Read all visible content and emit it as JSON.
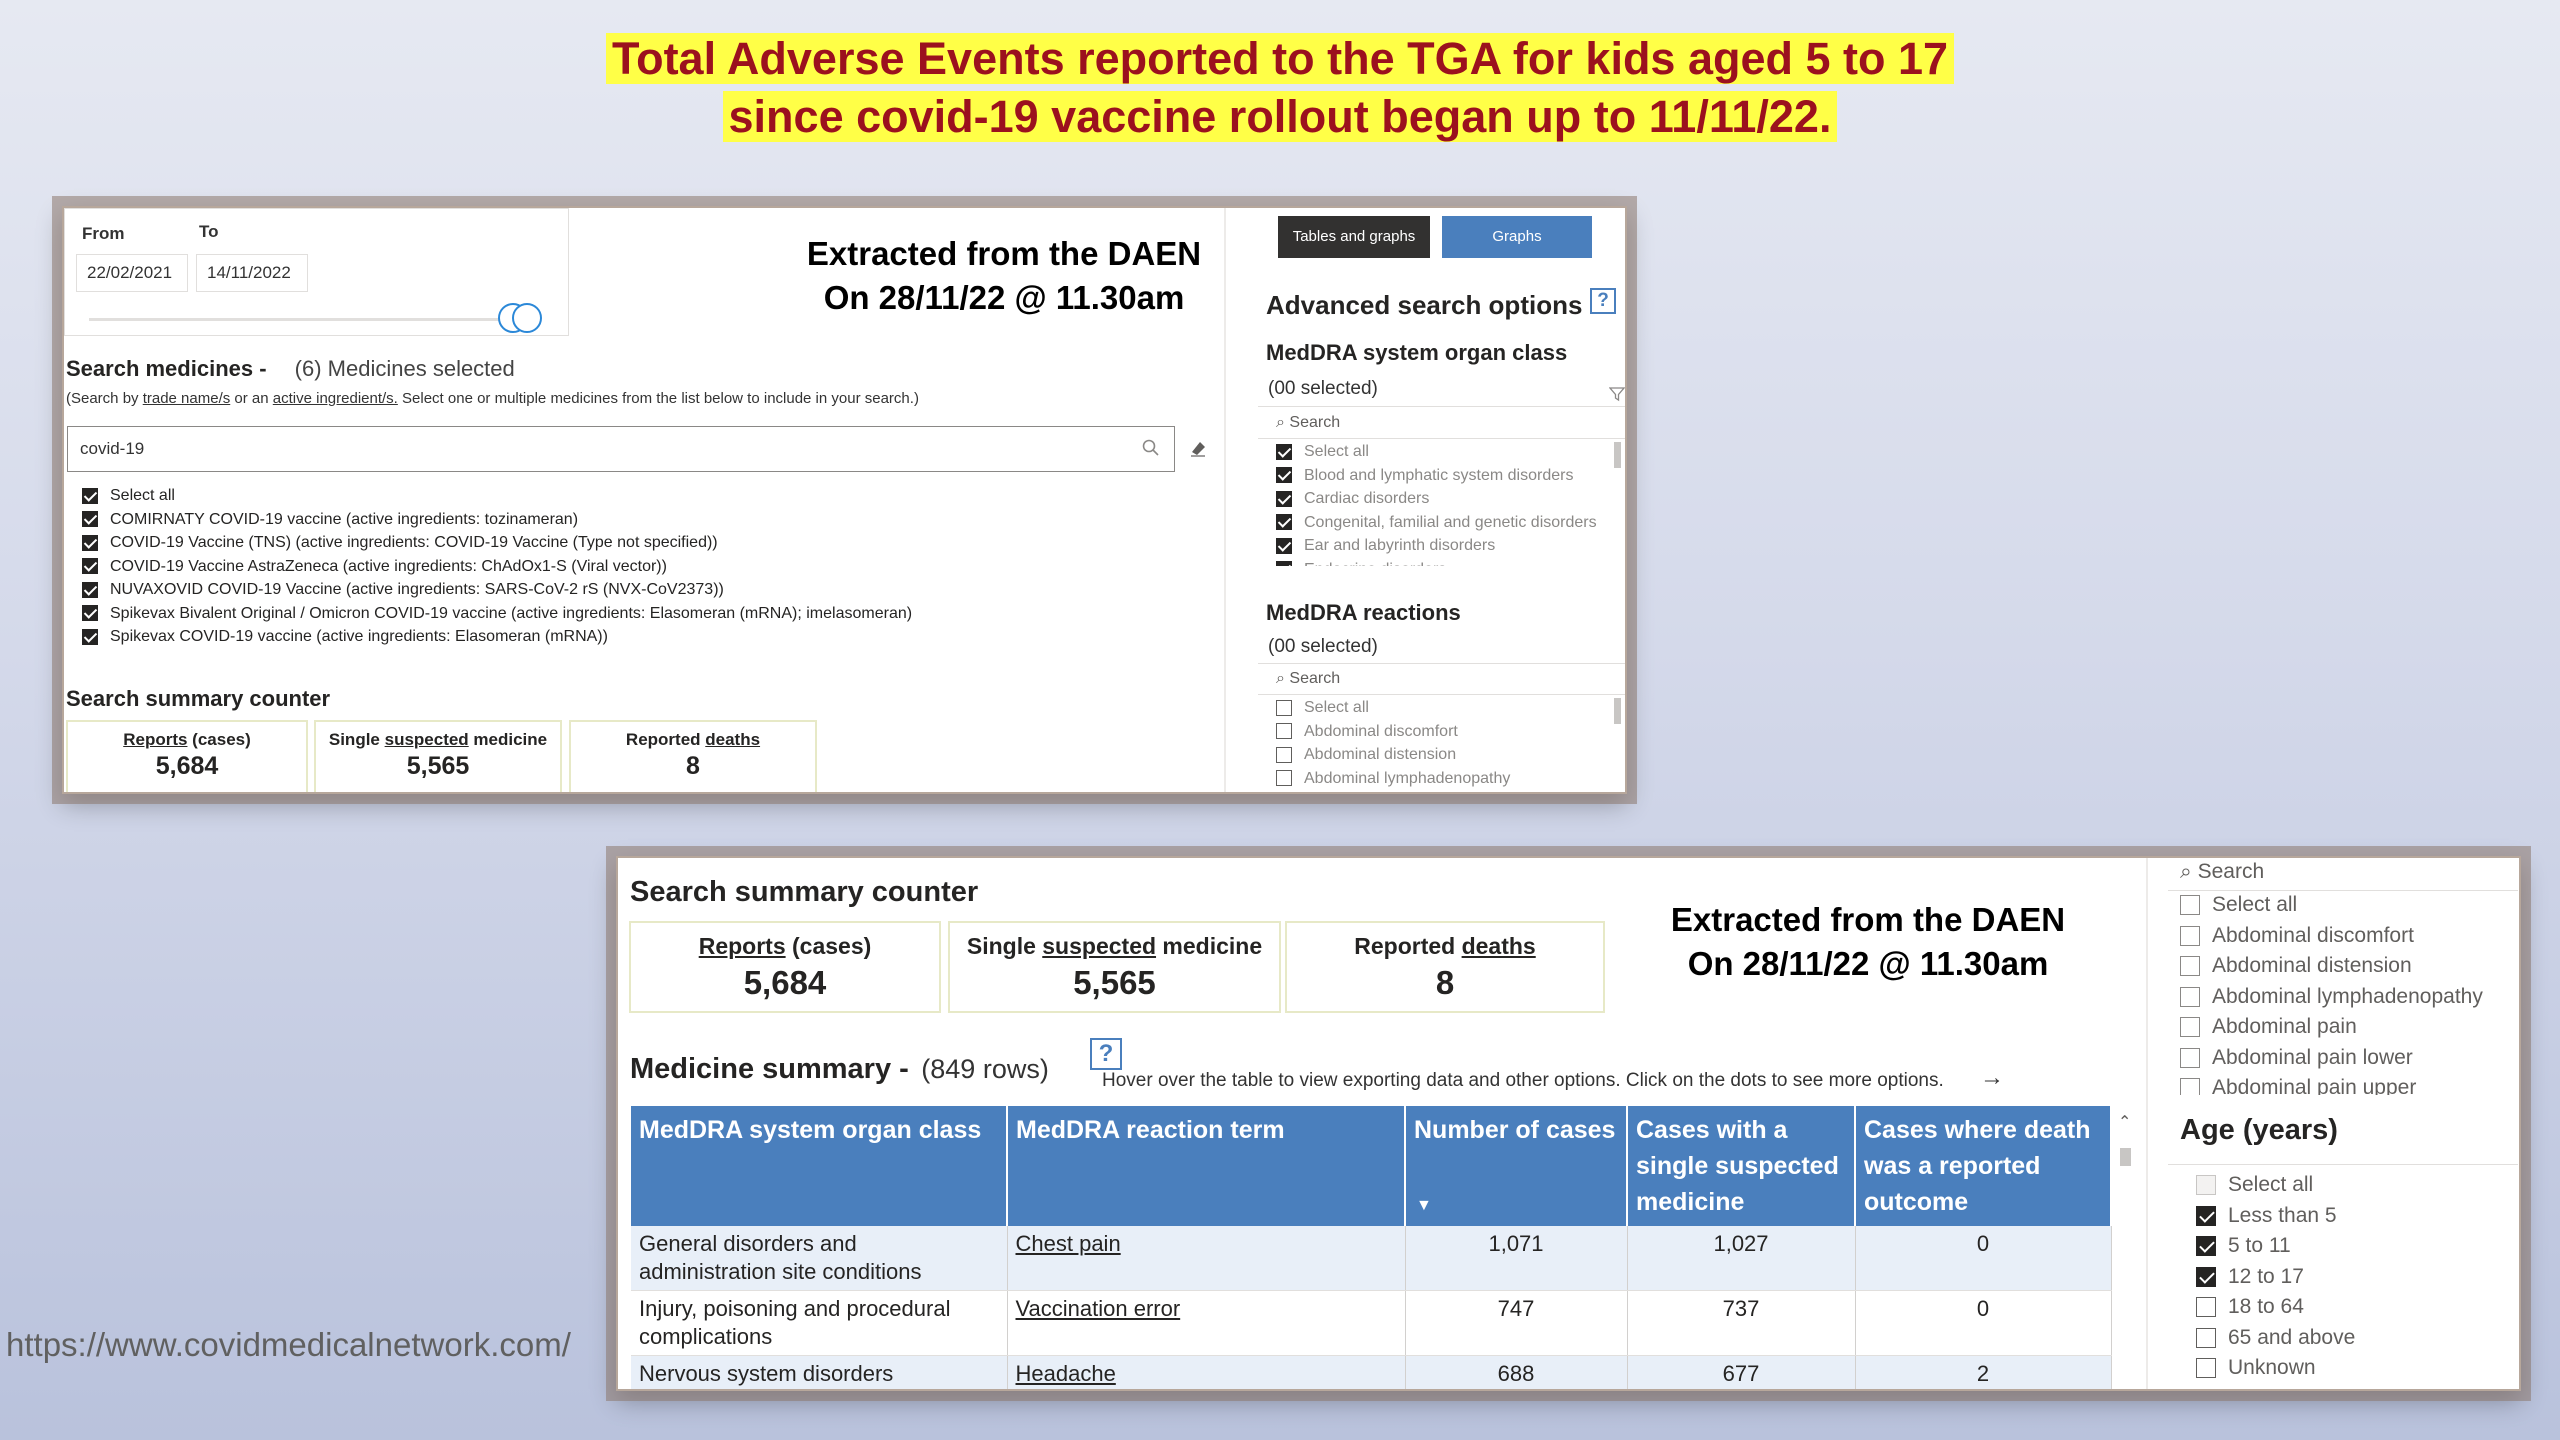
{
  "headline": {
    "line1": "Total Adverse Events reported to the TGA for kids aged 5 to 17",
    "line2": "since covid-19 vaccine rollout began up to 11/11/22."
  },
  "footer_url": "https://www.covidmedicalnetwork.com/",
  "extract_note": {
    "line1": "Extracted from the DAEN",
    "line2": "On 28/11/22 @ 11.30am"
  },
  "panel1": {
    "date_filter": {
      "from_label": "From",
      "to_label": "To",
      "from_value": "22/02/2021",
      "to_value": "14/11/2022"
    },
    "search_medicines": {
      "title": "Search medicines -",
      "count": "(6) Medicines selected",
      "hint_pre": "(Search by ",
      "hint_link1": "trade name/s",
      "hint_mid": " or an ",
      "hint_link2": "active ingredient/s.",
      "hint_post": " Select one or multiple medicines from the list below to include in your search.)",
      "search_value": "covid-19",
      "items": [
        {
          "label": "Select all",
          "checked": true
        },
        {
          "label": "COMIRNATY COVID-19 vaccine (active ingredients: tozinameran)",
          "checked": true
        },
        {
          "label": "COVID-19 Vaccine (TNS) (active ingredients: COVID-19 Vaccine (Type not specified))",
          "checked": true
        },
        {
          "label": "COVID-19 Vaccine AstraZeneca (active ingredients: ChAdOx1-S (Viral vector))",
          "checked": true
        },
        {
          "label": "NUVAXOVID COVID-19 Vaccine (active ingredients: SARS-CoV-2 rS (NVX-CoV2373))",
          "checked": true
        },
        {
          "label": "Spikevax Bivalent Original / Omicron COVID-19 vaccine (active ingredients: Elasomeran (mRNA); imelasomeran)",
          "checked": true
        },
        {
          "label": "Spikevax COVID-19 vaccine (active ingredients: Elasomeran (mRNA))",
          "checked": true
        }
      ]
    },
    "summary": {
      "title": "Search summary counter",
      "reports_label_u": "Reports",
      "reports_label_rest": " (cases)",
      "reports_value": "5,684",
      "single_label_pre": "Single ",
      "single_label_u": "suspected",
      "single_label_post": " medicine",
      "single_value": "5,565",
      "deaths_label_pre": "Reported ",
      "deaths_label_u": "deaths",
      "deaths_value": "8"
    },
    "buttons": {
      "tables_and_graphs": "Tables and graphs",
      "graphs": "Graphs"
    },
    "advanced": {
      "title": "Advanced search options",
      "help": "?",
      "organ_class_title": "MedDRA system organ class",
      "organ_class_selected": "(00 selected)",
      "search_placeholder": "Search",
      "organ_items": [
        {
          "label": "Select all",
          "checked": true
        },
        {
          "label": "Blood and lymphatic system disorders",
          "checked": true
        },
        {
          "label": "Cardiac disorders",
          "checked": true
        },
        {
          "label": "Congenital, familial and genetic disorders",
          "checked": true
        },
        {
          "label": "Ear and labyrinth disorders",
          "checked": true
        },
        {
          "label": "Endocrine disorders",
          "checked": true
        }
      ],
      "reactions_title": "MedDRA reactions",
      "reactions_selected": "(00 selected)",
      "reaction_items": [
        {
          "label": "Select all",
          "checked": false
        },
        {
          "label": "Abdominal discomfort",
          "checked": false
        },
        {
          "label": "Abdominal distension",
          "checked": false
        },
        {
          "label": "Abdominal lymphadenopathy",
          "checked": false
        }
      ]
    }
  },
  "panel2": {
    "summary": {
      "title": "Search summary counter",
      "reports_label_u": "Reports",
      "reports_label_rest": " (cases)",
      "reports_value": "5,684",
      "single_label_pre": "Single ",
      "single_label_u": "suspected",
      "single_label_post": " medicine",
      "single_value": "5,565",
      "deaths_label_pre": "Reported ",
      "deaths_label_u": "deaths",
      "deaths_value": "8"
    },
    "medicine_summary": {
      "title": "Medicine summary -",
      "rows_count": "(849 rows)",
      "help": "?",
      "hint": "Hover over the table to view exporting data and other options. Click on the dots to see more options.",
      "columns": [
        "MedDRA system organ class",
        "MedDRA reaction term",
        "Number of cases",
        "Cases with a single suspected medicine",
        "Cases where death was a reported outcome"
      ],
      "rows": [
        [
          "General disorders and administration site conditions",
          "Chest pain",
          "1,071",
          "1,027",
          "0"
        ],
        [
          "Injury, poisoning and procedural complications",
          "Vaccination error",
          "747",
          "737",
          "0"
        ],
        [
          "Nervous system disorders",
          "Headache",
          "688",
          "677",
          "2"
        ]
      ]
    },
    "reactions_filter": {
      "search_placeholder": "Search",
      "items": [
        {
          "label": "Select all",
          "checked": false
        },
        {
          "label": "Abdominal discomfort",
          "checked": false
        },
        {
          "label": "Abdominal distension",
          "checked": false
        },
        {
          "label": "Abdominal lymphadenopathy",
          "checked": false
        },
        {
          "label": "Abdominal pain",
          "checked": false
        },
        {
          "label": "Abdominal pain lower",
          "checked": false
        },
        {
          "label": "Abdominal pain upper",
          "checked": false
        }
      ]
    },
    "age_filter": {
      "title": "Age (years)",
      "items": [
        {
          "label": "Select all",
          "checked": false,
          "partial": true
        },
        {
          "label": "Less than 5",
          "checked": true
        },
        {
          "label": "5 to 11",
          "checked": true
        },
        {
          "label": "12 to 17",
          "checked": true
        },
        {
          "label": "18 to 64",
          "checked": false
        },
        {
          "label": "65 and above",
          "checked": false
        },
        {
          "label": "Unknown",
          "checked": false
        }
      ]
    }
  },
  "colors": {
    "headline_text": "#9b111e",
    "headline_highlight": "#ffff47",
    "table_header": "#4a7fbd",
    "graphs_button": "#4a7fbd",
    "tables_button": "#323130"
  }
}
